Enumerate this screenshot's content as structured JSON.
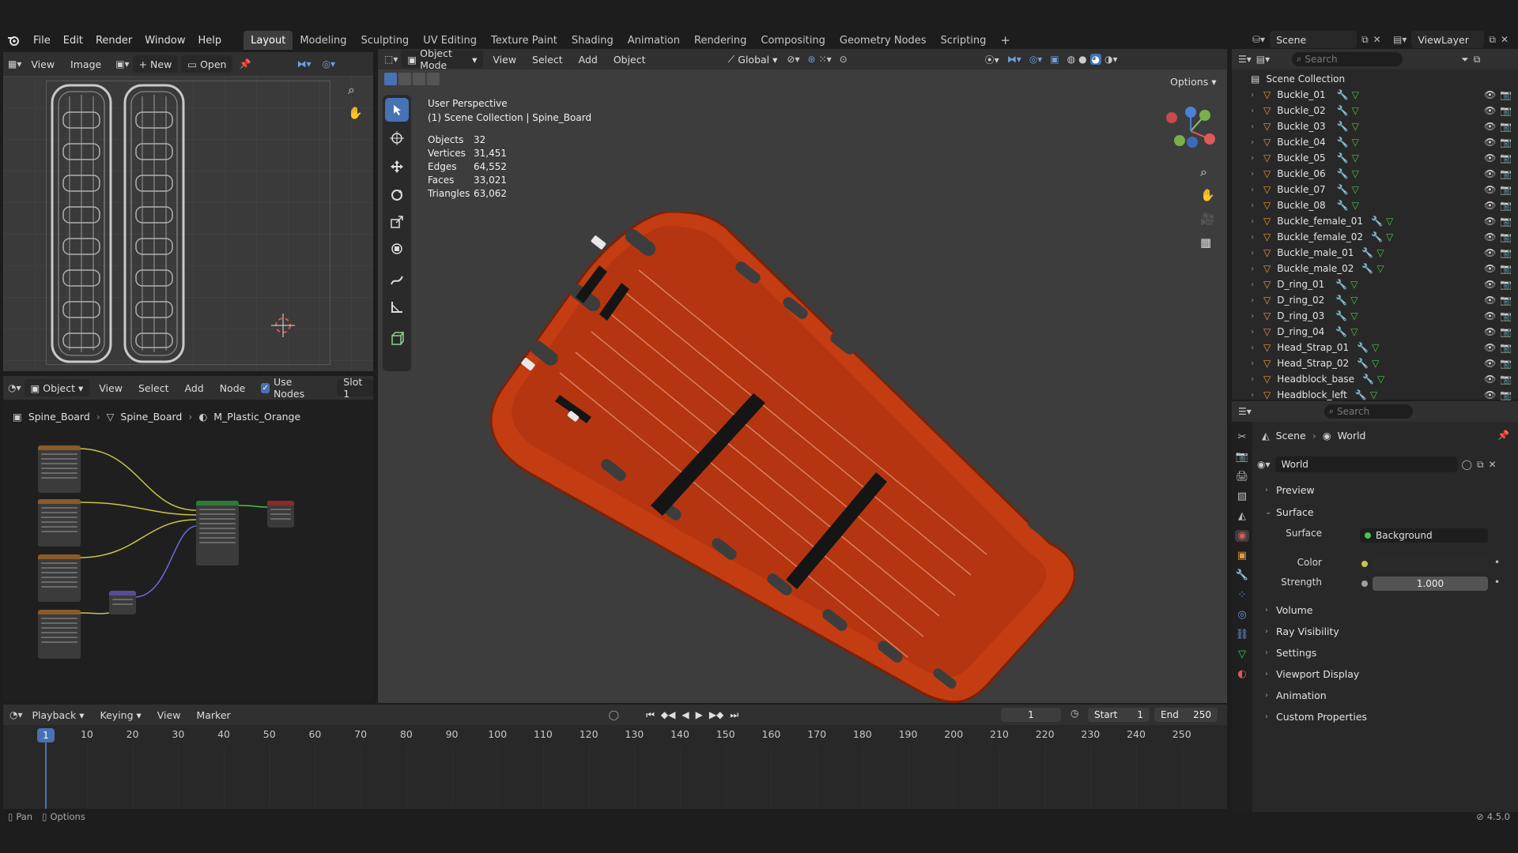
{
  "app": {
    "version": "4.5.0"
  },
  "topbar": {
    "menus": [
      "File",
      "Edit",
      "Render",
      "Window",
      "Help"
    ],
    "workspaces": [
      "Layout",
      "Modeling",
      "Sculpting",
      "UV Editing",
      "Texture Paint",
      "Shading",
      "Animation",
      "Rendering",
      "Compositing",
      "Geometry Nodes",
      "Scripting"
    ],
    "active_workspace": "Layout",
    "scene": "Scene",
    "view_layer": "ViewLayer"
  },
  "image_editor": {
    "menus": [
      "View",
      "Image"
    ],
    "new_label": "New",
    "open_label": "Open"
  },
  "node_editor": {
    "editor_type": "Object",
    "menus": [
      "View",
      "Select",
      "Add",
      "Node"
    ],
    "use_nodes_label": "Use Nodes",
    "use_nodes_checked": true,
    "slot": "Slot 1",
    "breadcrumb": [
      "Spine_Board",
      "Spine_Board",
      "M_Plastic_Orange"
    ]
  },
  "viewport": {
    "mode": "Object Mode",
    "menus": [
      "View",
      "Select",
      "Add",
      "Object"
    ],
    "orientation": "Global",
    "options_label": "Options",
    "perspective": "User Perspective",
    "collection_line": "(1) Scene Collection | Spine_Board",
    "stats": [
      {
        "label": "Objects",
        "value": "32"
      },
      {
        "label": "Vertices",
        "value": "31,451"
      },
      {
        "label": "Edges",
        "value": "64,552"
      },
      {
        "label": "Faces",
        "value": "33,021"
      },
      {
        "label": "Triangles",
        "value": "63,062"
      }
    ],
    "colors": {
      "board": "#c43c12",
      "strap": "#151515",
      "background": "#3d3d3d"
    }
  },
  "outliner": {
    "search_placeholder": "Search",
    "root": "Scene Collection",
    "items": [
      "Buckle_01",
      "Buckle_02",
      "Buckle_03",
      "Buckle_04",
      "Buckle_05",
      "Buckle_06",
      "Buckle_07",
      "Buckle_08",
      "Buckle_female_01",
      "Buckle_female_02",
      "Buckle_male_01",
      "Buckle_male_02",
      "D_ring_01",
      "D_ring_02",
      "D_ring_03",
      "D_ring_04",
      "Head_Strap_01",
      "Head_Strap_02",
      "Headblock_base",
      "Headblock_left"
    ]
  },
  "properties": {
    "search_placeholder": "Search",
    "breadcrumb": [
      "Scene",
      "World"
    ],
    "world_name": "World",
    "sections": {
      "preview": "Preview",
      "surface": "Surface",
      "volume": "Volume",
      "ray_visibility": "Ray Visibility",
      "settings": "Settings",
      "viewport_display": "Viewport Display",
      "animation": "Animation",
      "custom_properties": "Custom Properties"
    },
    "surface_label": "Surface",
    "surface_value": "Background",
    "color_label": "Color",
    "strength_label": "Strength",
    "strength_value": "1.000"
  },
  "timeline": {
    "menus": [
      "Playback",
      "Keying",
      "View",
      "Marker"
    ],
    "current_frame": "1",
    "start_label": "Start",
    "start_value": "1",
    "end_label": "End",
    "end_value": "250",
    "playhead": "1",
    "ticks": [
      "10",
      "20",
      "30",
      "40",
      "50",
      "60",
      "70",
      "80",
      "90",
      "100",
      "110",
      "120",
      "130",
      "140",
      "150",
      "160",
      "170",
      "180",
      "190",
      "200",
      "210",
      "220",
      "230",
      "240",
      "250"
    ]
  },
  "statusbar": {
    "pan": "Pan",
    "options": "Options"
  }
}
